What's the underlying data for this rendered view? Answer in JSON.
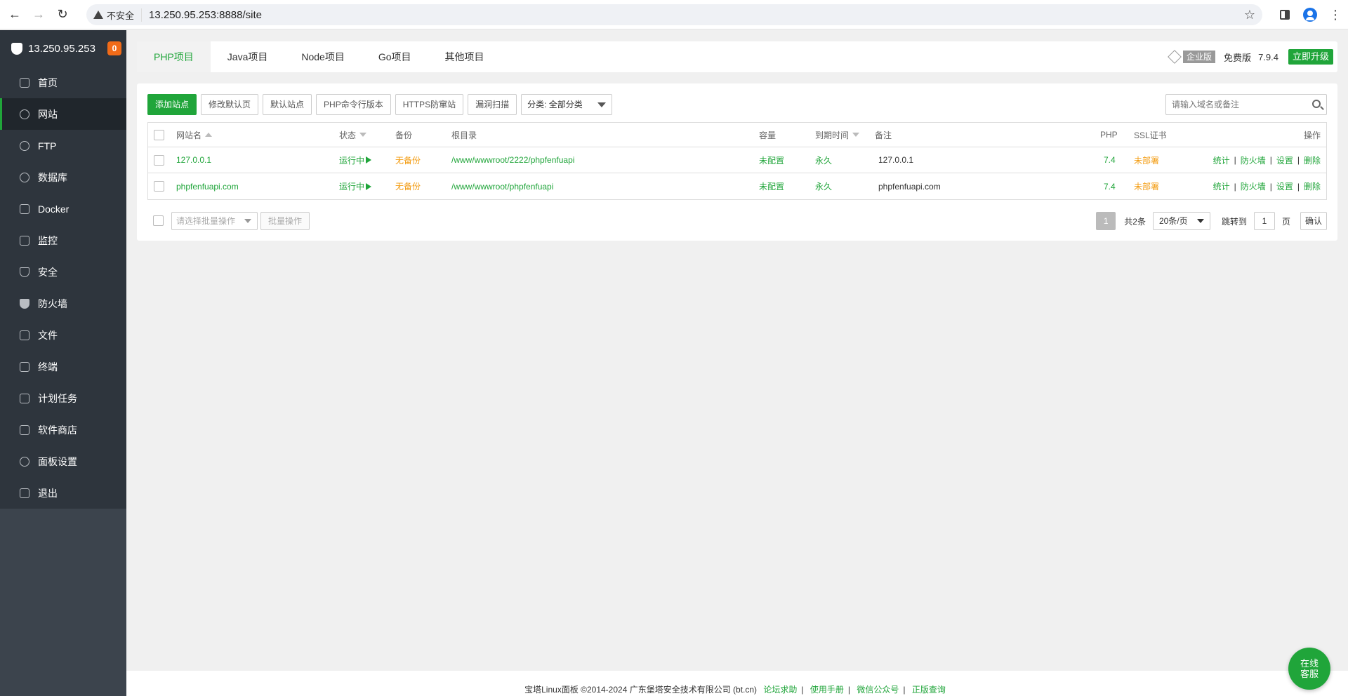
{
  "browser": {
    "security_label": "不安全",
    "url": "13.250.95.253:8888/site"
  },
  "sidebar": {
    "server": "13.250.95.253",
    "badge": "0",
    "items": [
      {
        "label": "首页",
        "icon": "home-icon"
      },
      {
        "label": "网站",
        "icon": "globe-icon"
      },
      {
        "label": "FTP",
        "icon": "ftp-icon"
      },
      {
        "label": "数据库",
        "icon": "database-icon"
      },
      {
        "label": "Docker",
        "icon": "docker-icon"
      },
      {
        "label": "监控",
        "icon": "monitor-icon"
      },
      {
        "label": "安全",
        "icon": "shield-check-icon"
      },
      {
        "label": "防火墙",
        "icon": "firewall-shield-icon"
      },
      {
        "label": "文件",
        "icon": "folder-icon"
      },
      {
        "label": "终端",
        "icon": "terminal-icon"
      },
      {
        "label": "计划任务",
        "icon": "calendar-icon"
      },
      {
        "label": "软件商店",
        "icon": "apps-grid-icon"
      },
      {
        "label": "面板设置",
        "icon": "gear-icon"
      },
      {
        "label": "退出",
        "icon": "logout-icon"
      }
    ]
  },
  "tabs": [
    "PHP项目",
    "Java项目",
    "Node项目",
    "Go项目",
    "其他项目"
  ],
  "edition": {
    "enterprise": "企业版",
    "free": "免费版",
    "version": "7.9.4",
    "upgrade": "立即升级"
  },
  "toolbar": {
    "add_site": "添加站点",
    "edit_default_page": "修改默认页",
    "default_site": "默认站点",
    "php_cli_version": "PHP命令行版本",
    "https_guard": "HTTPS防窜站",
    "vuln_scan": "漏洞扫描",
    "category": "分类: 全部分类",
    "search_placeholder": "请输入域名或备注"
  },
  "table": {
    "headers": {
      "name": "网站名",
      "status": "状态",
      "backup": "备份",
      "root": "根目录",
      "quota": "容量",
      "expire": "到期时间",
      "remark": "备注",
      "php": "PHP",
      "ssl": "SSL证书",
      "ops": "操作"
    },
    "rows": [
      {
        "name": "127.0.0.1",
        "status": "运行中",
        "backup": "无备份",
        "root": "/www/wwwroot/2222/phpfenfuapi",
        "quota": "未配置",
        "expire": "永久",
        "remark": "127.0.0.1",
        "php": "7.4",
        "ssl": "未部署"
      },
      {
        "name": "phpfenfuapi.com",
        "status": "运行中",
        "backup": "无备份",
        "root": "/www/wwwroot/phpfenfuapi",
        "quota": "未配置",
        "expire": "永久",
        "remark": "phpfenfuapi.com",
        "php": "7.4",
        "ssl": "未部署"
      }
    ],
    "ops": {
      "stats": "统计",
      "firewall": "防火墙",
      "settings": "设置",
      "delete": "删除",
      "sep": "|"
    }
  },
  "batch": {
    "placeholder": "请选择批量操作",
    "button": "批量操作"
  },
  "pager": {
    "current": "1",
    "total": "共2条",
    "per_page": "20条/页",
    "jump_label": "跳转到",
    "jump_value": "1",
    "page_unit": "页",
    "confirm": "确认"
  },
  "footer": {
    "copyright": "宝塔Linux面板 ©2014-2024 广东堡塔安全技术有限公司 (bt.cn)",
    "links": [
      "论坛求助",
      "使用手册",
      "微信公众号",
      "正版查询"
    ]
  },
  "chat": "在线客服",
  "colors": {
    "accent": "#20a53a",
    "warning": "#f39c12",
    "sidebar": "#3c444d"
  }
}
